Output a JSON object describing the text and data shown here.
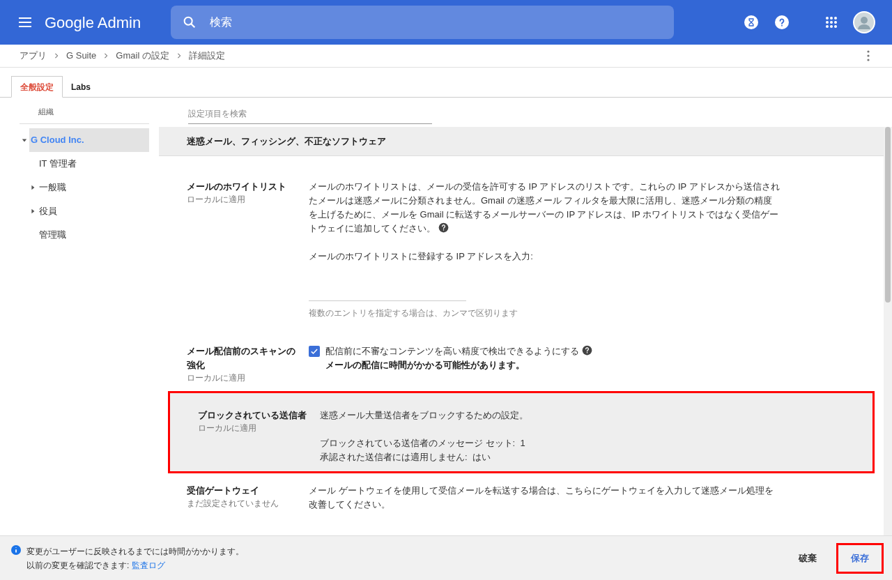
{
  "header": {
    "logo": "Google Admin",
    "search": {
      "placeholder": "検索"
    }
  },
  "breadcrumbs": [
    "アプリ",
    "G Suite",
    "Gmail の設定",
    "詳細設定"
  ],
  "tabs": [
    {
      "label": "全般設定",
      "selected": true
    },
    {
      "label": "Labs",
      "selected": false
    }
  ],
  "sidebar": {
    "heading": "組織",
    "items": [
      {
        "label": "G Cloud Inc.",
        "selected": true,
        "expanded": true,
        "children": [
          {
            "label": "IT 管理者",
            "selected": false
          },
          {
            "label": "一般職",
            "selected": false,
            "expanded": false
          },
          {
            "label": "役員",
            "selected": false,
            "expanded": false
          },
          {
            "label": "管理職",
            "selected": false
          }
        ]
      }
    ]
  },
  "settings_search": {
    "placeholder": "設定項目を検索"
  },
  "section": {
    "title": "迷惑メール、フィッシング、不正なソフトウェア"
  },
  "settings": [
    {
      "title": "メールのホワイトリスト",
      "subtitle": "ローカルに適用",
      "highlighted": false,
      "blocks": [
        {
          "kind": "paragraph",
          "text": "メールのホワイトリストは、メールの受信を許可する IP アドレスのリストです。これらの IP アドレスから送信されたメールは迷惑メールに分類されません。Gmail の迷惑メール フィルタを最大限に活用し、迷惑メール分類の精度を上げるために、メールを Gmail に転送するメールサーバーの IP アドレスは、IP ホワイトリストではなく受信ゲートウェイに追加してください。",
          "help": true
        },
        {
          "kind": "field",
          "label": "メールのホワイトリストに登録する IP アドレスを入力:",
          "hint": "複数のエントリを指定する場合は、カンマで区切ります"
        }
      ]
    },
    {
      "title": "メール配信前のスキャンの強化",
      "subtitle": "ローカルに適用",
      "highlighted": false,
      "blocks": [
        {
          "kind": "checkbox",
          "checked": true,
          "text": "配信前に不審なコンテンツを高い精度で検出できるようにする",
          "note": "メールの配信に時間がかかる可能性があります。",
          "help": true
        }
      ]
    },
    {
      "title": "ブロックされている送信者",
      "subtitle": "ローカルに適用",
      "highlighted": true,
      "blocks": [
        {
          "kind": "paragraph",
          "text": "迷惑メール大量送信者をブロックするための設定。",
          "help": false
        },
        {
          "kind": "lines",
          "lines": [
            "ブロックされている送信者のメッセージ セット:  1",
            "承認された送信者には適用しません:  はい"
          ]
        }
      ]
    },
    {
      "title": "受信ゲートウェイ",
      "subtitle": "まだ設定されていません",
      "highlighted": false,
      "blocks": [
        {
          "kind": "paragraph",
          "text": "メール ゲートウェイを使用して受信メールを転送する場合は、こちらにゲートウェイを入力して迷惑メール処理を改善してください。",
          "help": false
        }
      ]
    }
  ],
  "footer": {
    "lines": [
      "変更がユーザーに反映されるまでには時間がかかります。",
      "以前の変更を確認できます:"
    ],
    "link": "監査ログ",
    "discard": "破棄",
    "save": {
      "label": "保存",
      "highlighted": true
    }
  }
}
